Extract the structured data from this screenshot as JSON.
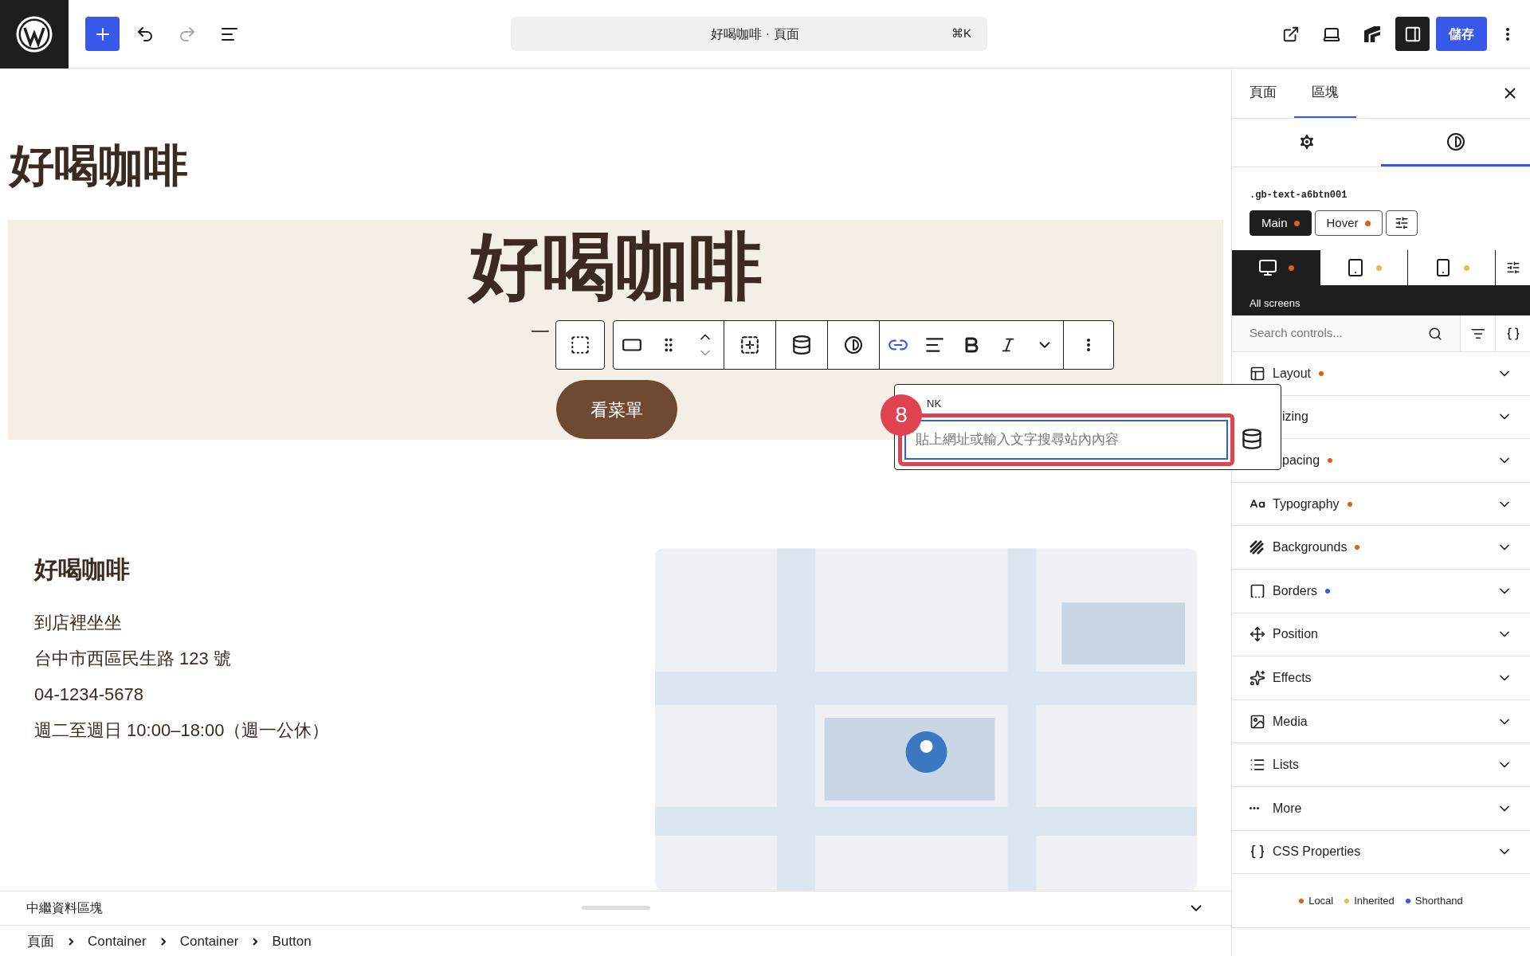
{
  "topbar": {
    "document_title": "好喝咖啡 · 頁面",
    "shortcut": "⌘K",
    "redo_disabled": true,
    "sidebar_toggle_on": true,
    "save_button": "儲存"
  },
  "canvas": {
    "site_title": "好喝咖啡",
    "hero": {
      "title": "好喝咖啡",
      "subtitle": "一",
      "button": "看菜單"
    },
    "block_toolbar": {
      "link_active": true
    },
    "link_popup": {
      "label": "NK",
      "placeholder": "貼上網址或輸入文字搜尋站內內容",
      "step_badge": "8"
    },
    "info": {
      "heading": "好喝咖啡",
      "lines": [
        "到店裡坐坐",
        "台中市西區民生路 123 號",
        "04-1234-5678",
        "週二至週日 10:00–18:00（週一公休）"
      ]
    }
  },
  "metadata_panel": {
    "title": "中繼資料區塊",
    "expanded": false
  },
  "breadcrumb": [
    "頁面",
    "Container",
    "Container",
    "Button"
  ],
  "sidebar": {
    "tabs": [
      {
        "label": "頁面",
        "selected": false
      },
      {
        "label": "區塊",
        "selected": true
      }
    ],
    "icon_tabs": [
      {
        "kind": "settings",
        "selected": false
      },
      {
        "kind": "styles",
        "selected": true
      }
    ],
    "selector": ".gb-text-a6btn001",
    "states": [
      {
        "label": "Main",
        "selected": true,
        "color": "#e35d1c"
      },
      {
        "label": "Hover",
        "selected": false,
        "color": "#e35d1c"
      }
    ],
    "devices": [
      {
        "kind": "desktop",
        "selected": true,
        "color": "#e35d1c"
      },
      {
        "kind": "tablet",
        "selected": false,
        "color": "#f0b849"
      },
      {
        "kind": "mobile",
        "selected": false,
        "color": "#f0b849"
      }
    ],
    "device_label": "All screens",
    "search": {
      "placeholder": "Search controls..."
    },
    "panels": [
      {
        "label": "Layout",
        "color": "#e35d1c"
      },
      {
        "label": "izing"
      },
      {
        "label": "pacing",
        "color": "#e35d1c"
      },
      {
        "label": "Typography",
        "color": "#e35d1c"
      },
      {
        "label": "Backgrounds",
        "color": "#e35d1c"
      },
      {
        "label": "Borders",
        "color": "#3858e9"
      },
      {
        "label": "Position"
      },
      {
        "label": "Effects"
      },
      {
        "label": "Media"
      },
      {
        "label": "Lists"
      },
      {
        "label": "More"
      },
      {
        "label": "CSS Properties"
      }
    ],
    "legend": [
      {
        "label": "Local",
        "color": "#e35d1c"
      },
      {
        "label": "Inherited",
        "color": "#f0b849"
      },
      {
        "label": "Shorthand",
        "color": "#3858e9"
      }
    ]
  }
}
